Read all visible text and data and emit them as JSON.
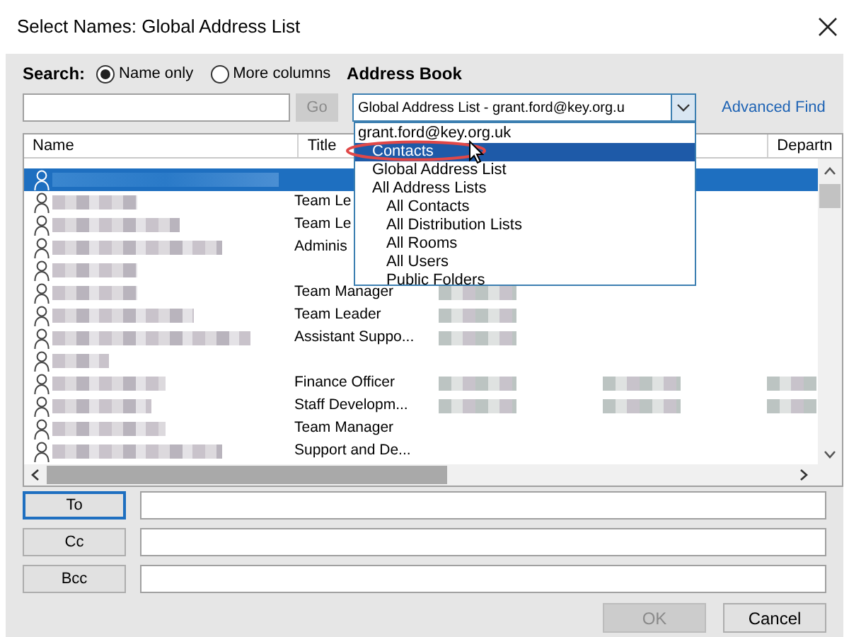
{
  "window": {
    "title": "Select Names: Global Address List"
  },
  "search": {
    "label": "Search:",
    "options": [
      {
        "label": "Name only",
        "selected": true
      },
      {
        "label": "More columns",
        "selected": false
      }
    ],
    "go_button": {
      "label": "Go",
      "disabled": true
    }
  },
  "address_book": {
    "label": "Address Book",
    "value": "Global Address List - grant.ford@key.org.u",
    "expanded": true,
    "options": [
      {
        "label": "grant.ford@key.org.uk",
        "selected": false,
        "children": [
          {
            "label": "Contacts",
            "selected": true
          },
          {
            "label": "Global Address List",
            "selected": false
          },
          {
            "label": "All Address Lists",
            "selected": false,
            "children": [
              {
                "label": "All Contacts",
                "selected": false
              },
              {
                "label": "All Distribution Lists",
                "selected": false
              },
              {
                "label": "All Rooms",
                "selected": false
              },
              {
                "label": "All Users",
                "selected": false
              },
              {
                "label": "Public Folders",
                "selected": false
              }
            ]
          }
        ]
      }
    ]
  },
  "advanced_find": "Advanced Find",
  "table": {
    "columns": [
      "Name",
      "Title",
      "Departn"
    ],
    "rows": [
      {
        "selected": true
      },
      {
        "title": "Team Le",
        "selected": false
      },
      {
        "title": "Team Le",
        "selected": false
      },
      {
        "title": "Adminis",
        "selected": false
      },
      {
        "selected": false
      },
      {
        "title": "Team Manager",
        "selected": false
      },
      {
        "title": "Team Leader",
        "selected": false
      },
      {
        "title": "Assistant Suppo...",
        "selected": false
      },
      {
        "selected": false
      },
      {
        "title": "Finance Officer",
        "selected": false
      },
      {
        "title": "Staff Developm...",
        "selected": false
      },
      {
        "title": "Team Manager",
        "selected": false
      },
      {
        "title": "Support and De...",
        "selected": false
      }
    ]
  },
  "recipients": [
    {
      "label": "To",
      "focused": true
    },
    {
      "label": "Cc",
      "focused": false
    },
    {
      "label": "Bcc",
      "focused": false
    }
  ],
  "buttons": [
    {
      "label": "OK",
      "disabled": true
    },
    {
      "label": "Cancel",
      "disabled": false
    }
  ]
}
